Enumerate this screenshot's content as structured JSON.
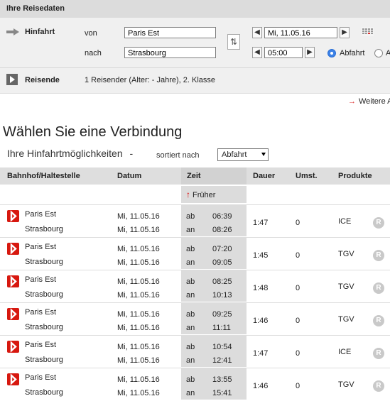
{
  "panel": {
    "title": "Ihre Reisedaten",
    "hinfahrt_label": "Hinfahrt",
    "von_label": "von",
    "nach_label": "nach",
    "von_value": "Paris Est",
    "nach_value": "Strasbourg",
    "date_value": "Mi, 11.05.16",
    "time_value": "05:00",
    "abfahrt_label": "Abfahrt",
    "ankunft_label": "A",
    "reisende_label": "Reisende",
    "reisende_value": "1 Reisender (Alter: - Jahre), 2. Klasse",
    "weitere_label": "Weitere A"
  },
  "heading": {
    "title": "Wählen Sie eine Verbindung",
    "subtitle": "Ihre Hinfahrtmöglichkeiten",
    "dash": "-",
    "sort_label": "sortiert nach",
    "sort_value": "Abfahrt"
  },
  "table": {
    "headers": {
      "station": "Bahnhof/Haltestelle",
      "date": "Datum",
      "time": "Zeit",
      "duration": "Dauer",
      "changes": "Umst.",
      "products": "Produkte"
    },
    "frueher": "Früher",
    "ab_label": "ab",
    "an_label": "an",
    "r_badge": "R",
    "rows": [
      {
        "from": "Paris Est",
        "to": "Strasbourg",
        "date1": "Mi, 11.05.16",
        "date2": "Mi, 11.05.16",
        "dep": "06:39",
        "arr": "08:26",
        "dur": "1:47",
        "chg": "0",
        "prod": "ICE"
      },
      {
        "from": "Paris Est",
        "to": "Strasbourg",
        "date1": "Mi, 11.05.16",
        "date2": "Mi, 11.05.16",
        "dep": "07:20",
        "arr": "09:05",
        "dur": "1:45",
        "chg": "0",
        "prod": "TGV"
      },
      {
        "from": "Paris Est",
        "to": "Strasbourg",
        "date1": "Mi, 11.05.16",
        "date2": "Mi, 11.05.16",
        "dep": "08:25",
        "arr": "10:13",
        "dur": "1:48",
        "chg": "0",
        "prod": "TGV"
      },
      {
        "from": "Paris Est",
        "to": "Strasbourg",
        "date1": "Mi, 11.05.16",
        "date2": "Mi, 11.05.16",
        "dep": "09:25",
        "arr": "11:11",
        "dur": "1:46",
        "chg": "0",
        "prod": "TGV"
      },
      {
        "from": "Paris Est",
        "to": "Strasbourg",
        "date1": "Mi, 11.05.16",
        "date2": "Mi, 11.05.16",
        "dep": "10:54",
        "arr": "12:41",
        "dur": "1:47",
        "chg": "0",
        "prod": "ICE"
      },
      {
        "from": "Paris Est",
        "to": "Strasbourg",
        "date1": "Mi, 11.05.16",
        "date2": "Mi, 11.05.16",
        "dep": "13:55",
        "arr": "15:41",
        "dur": "1:46",
        "chg": "0",
        "prod": "TGV"
      }
    ]
  },
  "colors": {
    "accent_red": "#d7180f",
    "radio_blue": "#2a6fd6"
  }
}
